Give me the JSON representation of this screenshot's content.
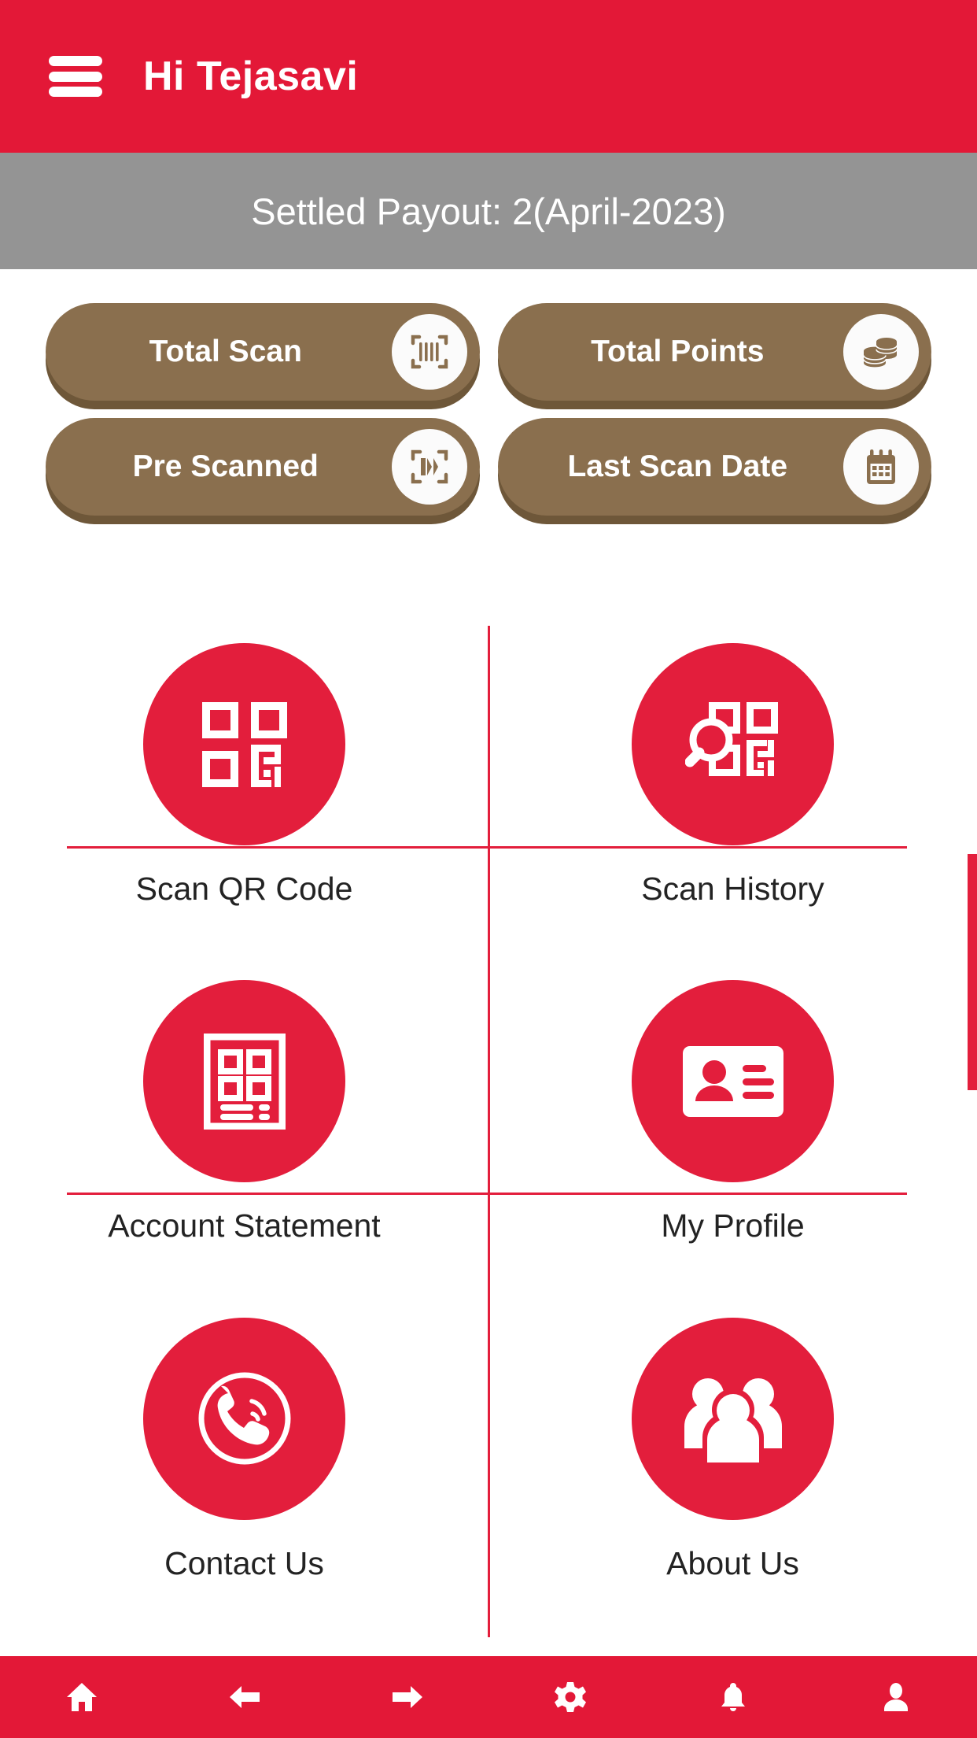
{
  "header": {
    "menu_icon": "hamburger-menu-icon",
    "greeting": "Hi Tejasavi"
  },
  "banner": {
    "text": "Settled Payout: 2(April-2023)",
    "background_color": "#949494"
  },
  "stats": {
    "rows": [
      [
        {
          "label": "Total Scan",
          "icon": "barcode-scan-icon"
        },
        {
          "label": "Total Points",
          "icon": "coins-stack-icon"
        }
      ],
      [
        {
          "label": "Pre Scanned",
          "icon": "qr-scan-frame-icon"
        },
        {
          "label": "Last Scan Date",
          "icon": "calendar-icon"
        }
      ]
    ],
    "pill_color": "#8A6F4E",
    "pill_shadow_color": "#6E5739"
  },
  "menu": {
    "items": [
      {
        "label": "Scan QR Code",
        "icon": "qr-code-icon"
      },
      {
        "label": "Scan History",
        "icon": "qr-search-icon"
      },
      {
        "label": "Account Statement",
        "icon": "statement-document-icon"
      },
      {
        "label": "My Profile",
        "icon": "id-card-icon"
      },
      {
        "label": "Contact Us",
        "icon": "phone-call-icon"
      },
      {
        "label": "About Us",
        "icon": "people-group-icon"
      }
    ],
    "circle_color": "#E31E3C",
    "divider_color": "#E31E3C"
  },
  "bottom_nav": {
    "items": [
      {
        "name": "home",
        "icon": "home-icon"
      },
      {
        "name": "back",
        "icon": "arrow-left-icon"
      },
      {
        "name": "forward",
        "icon": "arrow-right-icon"
      },
      {
        "name": "settings",
        "icon": "gear-icon"
      },
      {
        "name": "notifications",
        "icon": "bell-icon"
      },
      {
        "name": "profile",
        "icon": "person-icon"
      }
    ],
    "background_color": "#E31837"
  },
  "colors": {
    "brand_red": "#E31837",
    "accent_red": "#E31E3C",
    "banner_grey": "#949494",
    "pill_brown": "#8A6F4E"
  }
}
